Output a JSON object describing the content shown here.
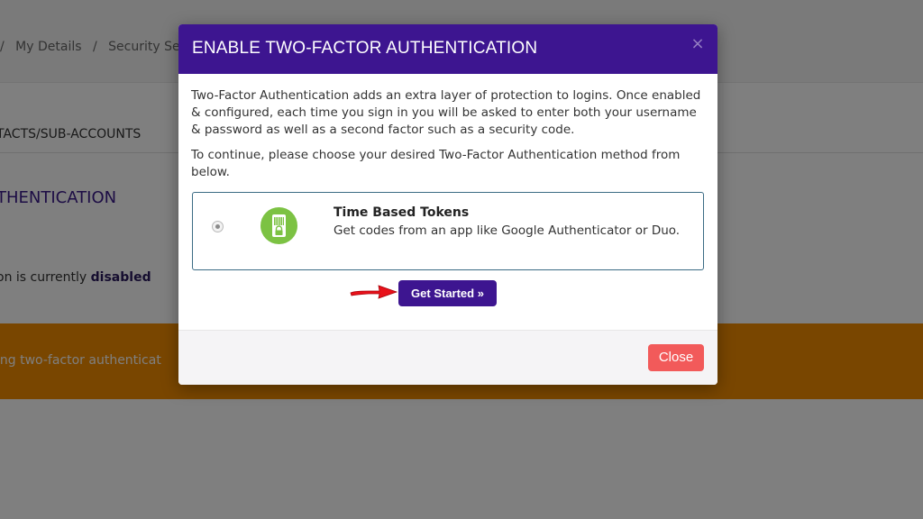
{
  "background": {
    "breadcrumb": [
      "/",
      "My Details",
      "/",
      "Security Se"
    ],
    "tab_label": "TACTS/SUB-ACCOUNTS",
    "heading": "THENTICATION",
    "status_prefix": "on is currently ",
    "status_value": "disabled",
    "warning_text": "ing two-factor authenticat"
  },
  "modal": {
    "title": "ENABLE TWO-FACTOR AUTHENTICATION",
    "close_x": "×",
    "intro": "Two-Factor Authentication adds an extra layer of protection to logins. Once enabled & configured, each time you sign in you will be asked to enter both your username & password as well as a second factor such as a security code.",
    "instruction": "To continue, please choose your desired Two-Factor Authentication method from below.",
    "method": {
      "title": "Time Based Tokens",
      "description": "Get codes from an app like Google Authenticator or Duo.",
      "icon": "phone-lock-icon",
      "selected": true
    },
    "get_started_label": "Get Started »",
    "close_label": "Close"
  },
  "colors": {
    "header": "#3d1590",
    "button_primary": "#3d1590",
    "close_button": "#f25a5a",
    "warning_banner": "#f28c00",
    "icon_green": "#7cc243",
    "arrow_red": "#e8111a"
  }
}
